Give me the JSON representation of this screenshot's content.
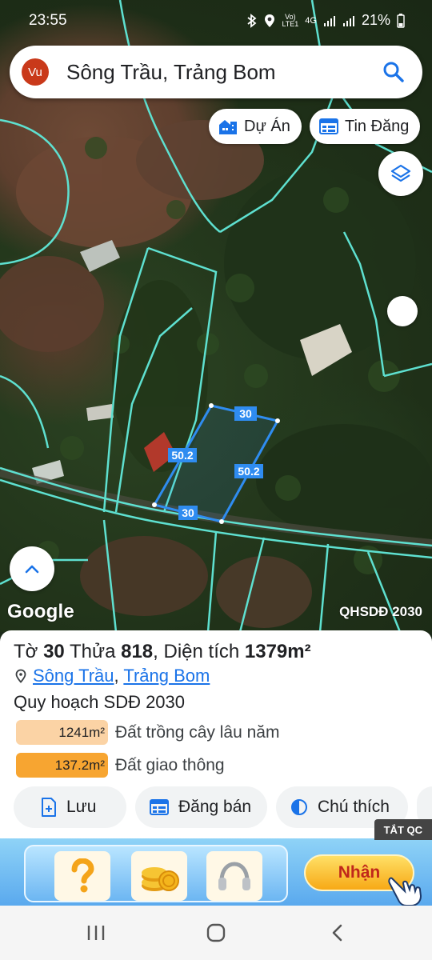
{
  "status_bar": {
    "time": "23:55",
    "network_label": "4G",
    "battery": "21%",
    "icons": [
      "bluetooth-icon",
      "location-icon",
      "volte-icon",
      "4g-icon",
      "signal-icon",
      "signal-icon",
      "battery-icon"
    ]
  },
  "search": {
    "avatar_initials": "Vu",
    "query": "Sông Trầu, Trảng Bom",
    "icon": "search-icon"
  },
  "chips": [
    {
      "label": "Dự Án",
      "icon": "building-icon"
    },
    {
      "label": "Tin Đăng",
      "icon": "listing-icon"
    }
  ],
  "map": {
    "provider": "Google",
    "layer_label": "QHSDĐ 2030",
    "parcel_edges": [
      "30",
      "50.2",
      "50.2",
      "30"
    ],
    "colors": {
      "boundary": "#5ee0d0",
      "parcel": "#2f8cf0",
      "label_bg": "#2f8cf0"
    }
  },
  "parcel": {
    "to_label": "Tờ",
    "to_value": "30",
    "thua_label": "Thửa",
    "thua_value": "818",
    "dien_tich_label": "Diện tích",
    "area_value": "1379m²",
    "ward": "Sông Trầu",
    "district": "Trảng Bom",
    "address_separator": ",",
    "plan_title": "Quy hoạch SDĐ 2030",
    "land_uses": [
      {
        "area": "1241m²",
        "label": "Đất trồng cây lâu năm",
        "color": "#fbd3a5"
      },
      {
        "area": "137.2m²",
        "label": "Đất giao thông",
        "color": "#f7a531"
      }
    ]
  },
  "actions": [
    {
      "label": "Lưu",
      "icon": "save-file-icon"
    },
    {
      "label": "Đăng bán",
      "icon": "calendar-list-icon"
    },
    {
      "label": "Chú thích",
      "icon": "half-circle-icon"
    }
  ],
  "ad": {
    "close_label": "TẮT QC",
    "cta_label": "Nhận",
    "tiles": [
      "question-mark-icon",
      "coins-icon",
      "headphones-icon"
    ]
  },
  "navbar": {
    "items": [
      "recent-apps-icon",
      "home-icon",
      "back-icon"
    ]
  }
}
